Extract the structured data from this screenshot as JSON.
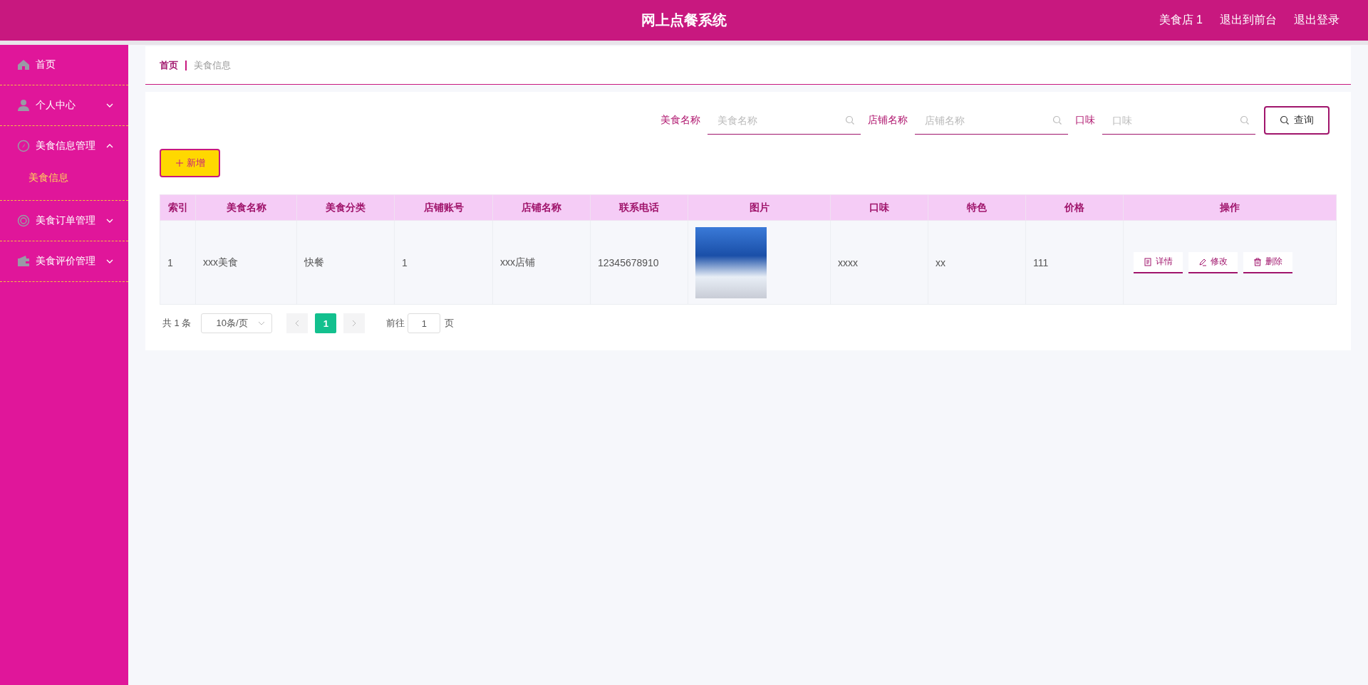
{
  "header": {
    "title": "网上点餐系统",
    "links": [
      "美食店 1",
      "退出到前台",
      "退出登录"
    ]
  },
  "sidebar": {
    "items": [
      {
        "label": "首页"
      },
      {
        "label": "个人中心",
        "expanded": false
      },
      {
        "label": "美食信息管理",
        "expanded": true,
        "children": [
          {
            "label": "美食信息",
            "selected": true
          }
        ]
      },
      {
        "label": "美食订单管理",
        "expanded": false
      },
      {
        "label": "美食评价管理",
        "expanded": false
      }
    ]
  },
  "breadcrumb": [
    "首页",
    "美食信息"
  ],
  "search": {
    "fields": [
      {
        "label": "美食名称",
        "placeholder": "美食名称"
      },
      {
        "label": "店铺名称",
        "placeholder": "店铺名称"
      },
      {
        "label": "口味",
        "placeholder": "口味"
      }
    ],
    "button": "查询"
  },
  "add_button": "新增",
  "table": {
    "columns": [
      "索引",
      "美食名称",
      "美食分类",
      "店铺账号",
      "店铺名称",
      "联系电话",
      "图片",
      "口味",
      "特色",
      "价格",
      "操作"
    ],
    "rows": [
      {
        "cells": [
          "1",
          "xxx美食",
          "快餐",
          "1",
          "xxx店铺",
          "12345678910",
          null,
          "xxxx",
          "xx",
          "111"
        ],
        "actions": [
          "详情",
          "修改",
          "删除"
        ]
      }
    ]
  },
  "pagination": {
    "total": "共 1 条",
    "page_size": "10条/页",
    "pages": [
      {
        "label": "1",
        "selected": true
      }
    ],
    "goto_label": "前往",
    "goto_value": "1",
    "goto_suffix": "页"
  }
}
